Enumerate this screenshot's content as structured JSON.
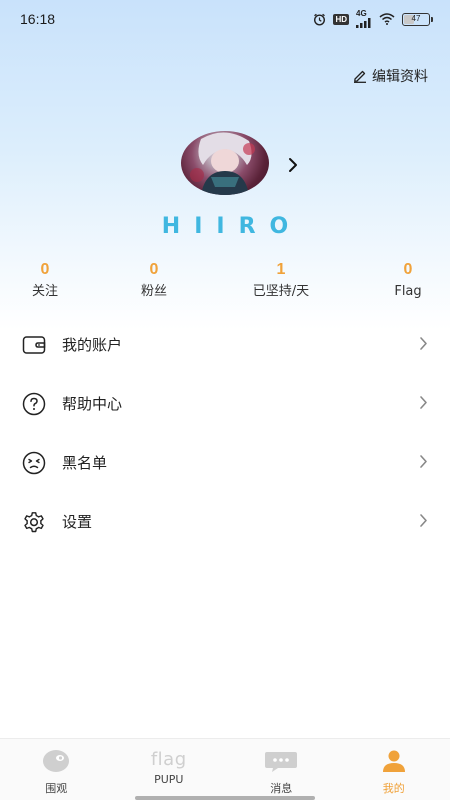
{
  "status_bar": {
    "time": "16:18",
    "network": "4G",
    "hd": "HD",
    "battery_percent": 47,
    "battery_text": "47"
  },
  "header": {
    "edit_profile_label": "编辑资料",
    "edit_icon": "pencil-icon"
  },
  "profile": {
    "username": "HIIRO",
    "username_color": "#40b7e0"
  },
  "stats": [
    {
      "value": "0",
      "label": "关注"
    },
    {
      "value": "0",
      "label": "粉丝"
    },
    {
      "value": "1",
      "label": "已坚持/天"
    },
    {
      "value": "0",
      "label": "Flag"
    }
  ],
  "menu": [
    {
      "label": "我的账户",
      "icon": "wallet-icon"
    },
    {
      "label": "帮助中心",
      "icon": "help-icon"
    },
    {
      "label": "黑名单",
      "icon": "blacklist-icon"
    },
    {
      "label": "设置",
      "icon": "settings-icon"
    }
  ],
  "tabbar": {
    "tabs": [
      {
        "label": "围观",
        "icon": "explore-icon",
        "active": false
      },
      {
        "label": "PUPU",
        "icon": "flag-icon",
        "icon_text": "flag",
        "active": false
      },
      {
        "label": "消息",
        "icon": "message-icon",
        "active": false
      },
      {
        "label": "我的",
        "icon": "profile-icon",
        "active": true
      }
    ]
  },
  "colors": {
    "accent": "#f0a23a",
    "username": "#40b7e0",
    "gradient_top": "#c9e2fb"
  }
}
